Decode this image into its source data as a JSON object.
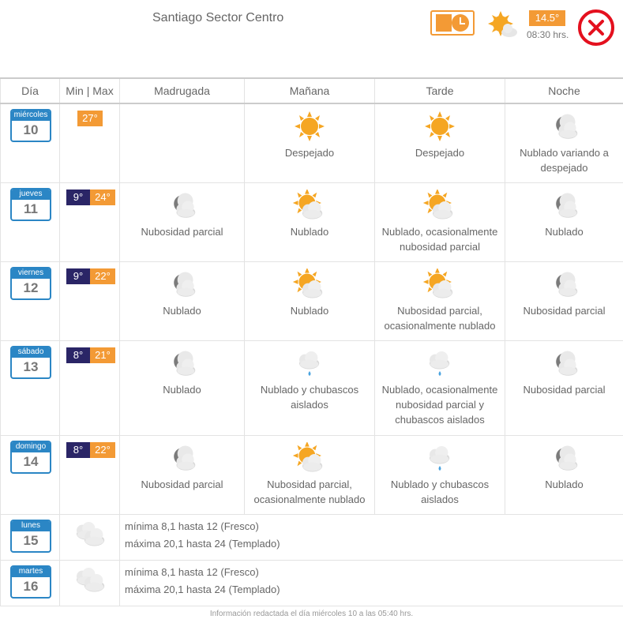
{
  "header": {
    "location": "Santiago Sector Centro",
    "current_temp": "14.5°",
    "current_time": "08:30 hrs.",
    "current_icon": "sun-cloud-icon",
    "station_icon": "thermometer-clock-icon",
    "close_icon": "close-icon"
  },
  "columns": [
    "Día",
    "Min | Max",
    "Madrugada",
    "Mañana",
    "Tarde",
    "Noche"
  ],
  "days": [
    {
      "day": "miércoles",
      "num": "10",
      "min": "",
      "max": "27°",
      "periods": [
        {
          "icon": "",
          "text": ""
        },
        {
          "icon": "sun",
          "text": "Despejado"
        },
        {
          "icon": "sun",
          "text": "Despejado"
        },
        {
          "icon": "cloud-moon",
          "text": "Nublado variando a despejado"
        }
      ]
    },
    {
      "day": "jueves",
      "num": "11",
      "min": "9°",
      "max": "24°",
      "periods": [
        {
          "icon": "moon-cloud",
          "text": "Nubosidad parcial"
        },
        {
          "icon": "sun-cloud",
          "text": "Nublado"
        },
        {
          "icon": "sun-cloud",
          "text": "Nublado, ocasionalmente nubosidad parcial"
        },
        {
          "icon": "cloud-moon",
          "text": "Nublado"
        }
      ]
    },
    {
      "day": "viernes",
      "num": "12",
      "min": "9°",
      "max": "22°",
      "periods": [
        {
          "icon": "cloud-moon",
          "text": "Nublado"
        },
        {
          "icon": "sun-cloud",
          "text": "Nublado"
        },
        {
          "icon": "sun-cloud",
          "text": "Nubosidad parcial, ocasionalmente nublado"
        },
        {
          "icon": "moon-cloud",
          "text": "Nubosidad parcial"
        }
      ]
    },
    {
      "day": "sábado",
      "num": "13",
      "min": "8°",
      "max": "21°",
      "periods": [
        {
          "icon": "cloud-moon",
          "text": "Nublado"
        },
        {
          "icon": "cloud-rain",
          "text": "Nublado y chubascos aislados"
        },
        {
          "icon": "cloud-rain",
          "text": "Nublado, ocasionalmente nubosidad parcial y chubascos aislados"
        },
        {
          "icon": "moon-cloud",
          "text": "Nubosidad parcial"
        }
      ]
    },
    {
      "day": "domingo",
      "num": "14",
      "min": "8°",
      "max": "22°",
      "periods": [
        {
          "icon": "moon-cloud",
          "text": "Nubosidad parcial"
        },
        {
          "icon": "sun-cloud",
          "text": "Nubosidad parcial, ocasionalmente nublado"
        },
        {
          "icon": "cloud-rain",
          "text": "Nublado y chubascos aislados"
        },
        {
          "icon": "cloud-moon",
          "text": "Nublado"
        }
      ]
    }
  ],
  "extended": [
    {
      "day": "lunes",
      "num": "15",
      "icon": "clouds",
      "line1": "mínima 8,1 hasta 12 (Fresco)",
      "line2": "máxima 20,1 hasta 24 (Templado)"
    },
    {
      "day": "martes",
      "num": "16",
      "icon": "clouds",
      "line1": "mínima 8,1 hasta 12 (Fresco)",
      "line2": "máxima 20,1 hasta 24 (Templado)"
    }
  ],
  "footer": "Información redactada el día miércoles 10 a las 05:40 hrs.",
  "colors": {
    "accent": "#f39a35",
    "min_badge": "#2a2566",
    "day_blue": "#2b86c5",
    "close_red": "#e4101e"
  }
}
